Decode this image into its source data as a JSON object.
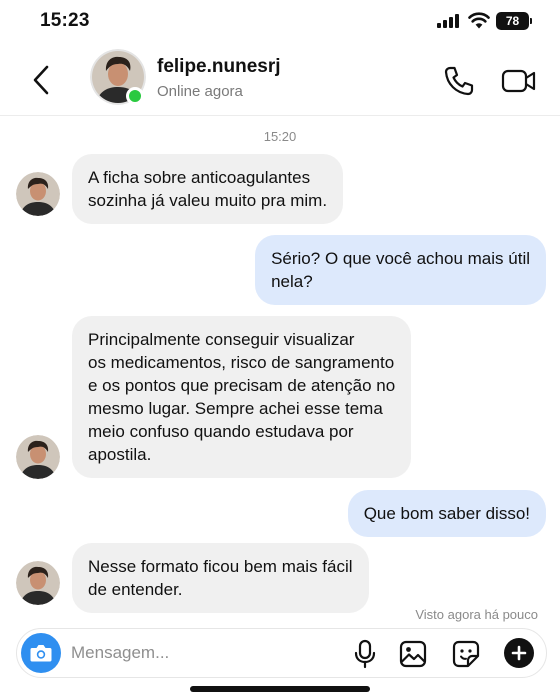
{
  "status_bar": {
    "time": "15:23",
    "battery": "78"
  },
  "header": {
    "username": "felipe.nunesrj",
    "presence": "Online agora"
  },
  "chat": {
    "timestamp": "15:20",
    "messages": [
      {
        "direction": "incoming",
        "line1": "A ficha sobre anticoagulantes",
        "line2": "sozinha já valeu muito pra mim."
      },
      {
        "direction": "outgoing",
        "line1": "Sério? O que você achou mais útil",
        "line2": "nela?"
      },
      {
        "direction": "incoming",
        "line1": "Principalmente conseguir visualizar",
        "line2": "os medicamentos, risco de sangramento",
        "line3": "e os pontos que precisam de atenção no",
        "line4": "mesmo lugar. Sempre achei esse tema",
        "line5": "meio confuso quando estudava por",
        "line6": "apostila."
      },
      {
        "direction": "outgoing",
        "line1": "Que bom saber disso!"
      },
      {
        "direction": "incoming",
        "line1": "Nesse formato ficou bem mais fácil",
        "line2": "de entender."
      }
    ],
    "seen_status": "Visto agora há pouco"
  },
  "composer": {
    "placeholder": "Mensagem..."
  },
  "icons": {
    "back": "chevron-left-icon",
    "call": "phone-icon",
    "video": "video-camera-icon",
    "camera": "camera-icon",
    "mic": "microphone-icon",
    "gallery": "image-icon",
    "sticker": "sticker-icon",
    "plus": "plus-icon"
  },
  "colors": {
    "online": "#2ac940",
    "outgoing_bubble": "#dde9fc",
    "incoming_bubble": "#f0f0f0",
    "camera_button": "#2f8ff0"
  }
}
